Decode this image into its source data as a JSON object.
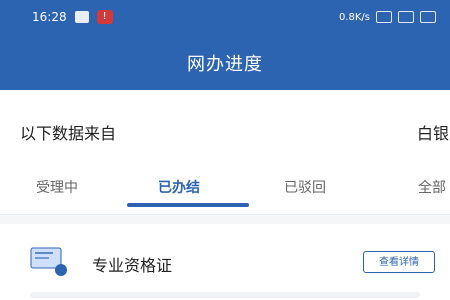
{
  "status_bar": {
    "time": "16:28",
    "badge": "!",
    "right_text": "0.8K/s"
  },
  "header": {
    "title": "网办进度"
  },
  "info": {
    "left_text": "以下数据来自",
    "right_text": "白银"
  },
  "tabs": [
    {
      "label": "受理中"
    },
    {
      "label": "已办结"
    },
    {
      "label": "已驳回"
    },
    {
      "label": "全部"
    }
  ],
  "card": {
    "title": "专业资格证",
    "action": "查看详情"
  },
  "colors": {
    "primary": "#2d64b1",
    "background": "#f5f6f8"
  }
}
